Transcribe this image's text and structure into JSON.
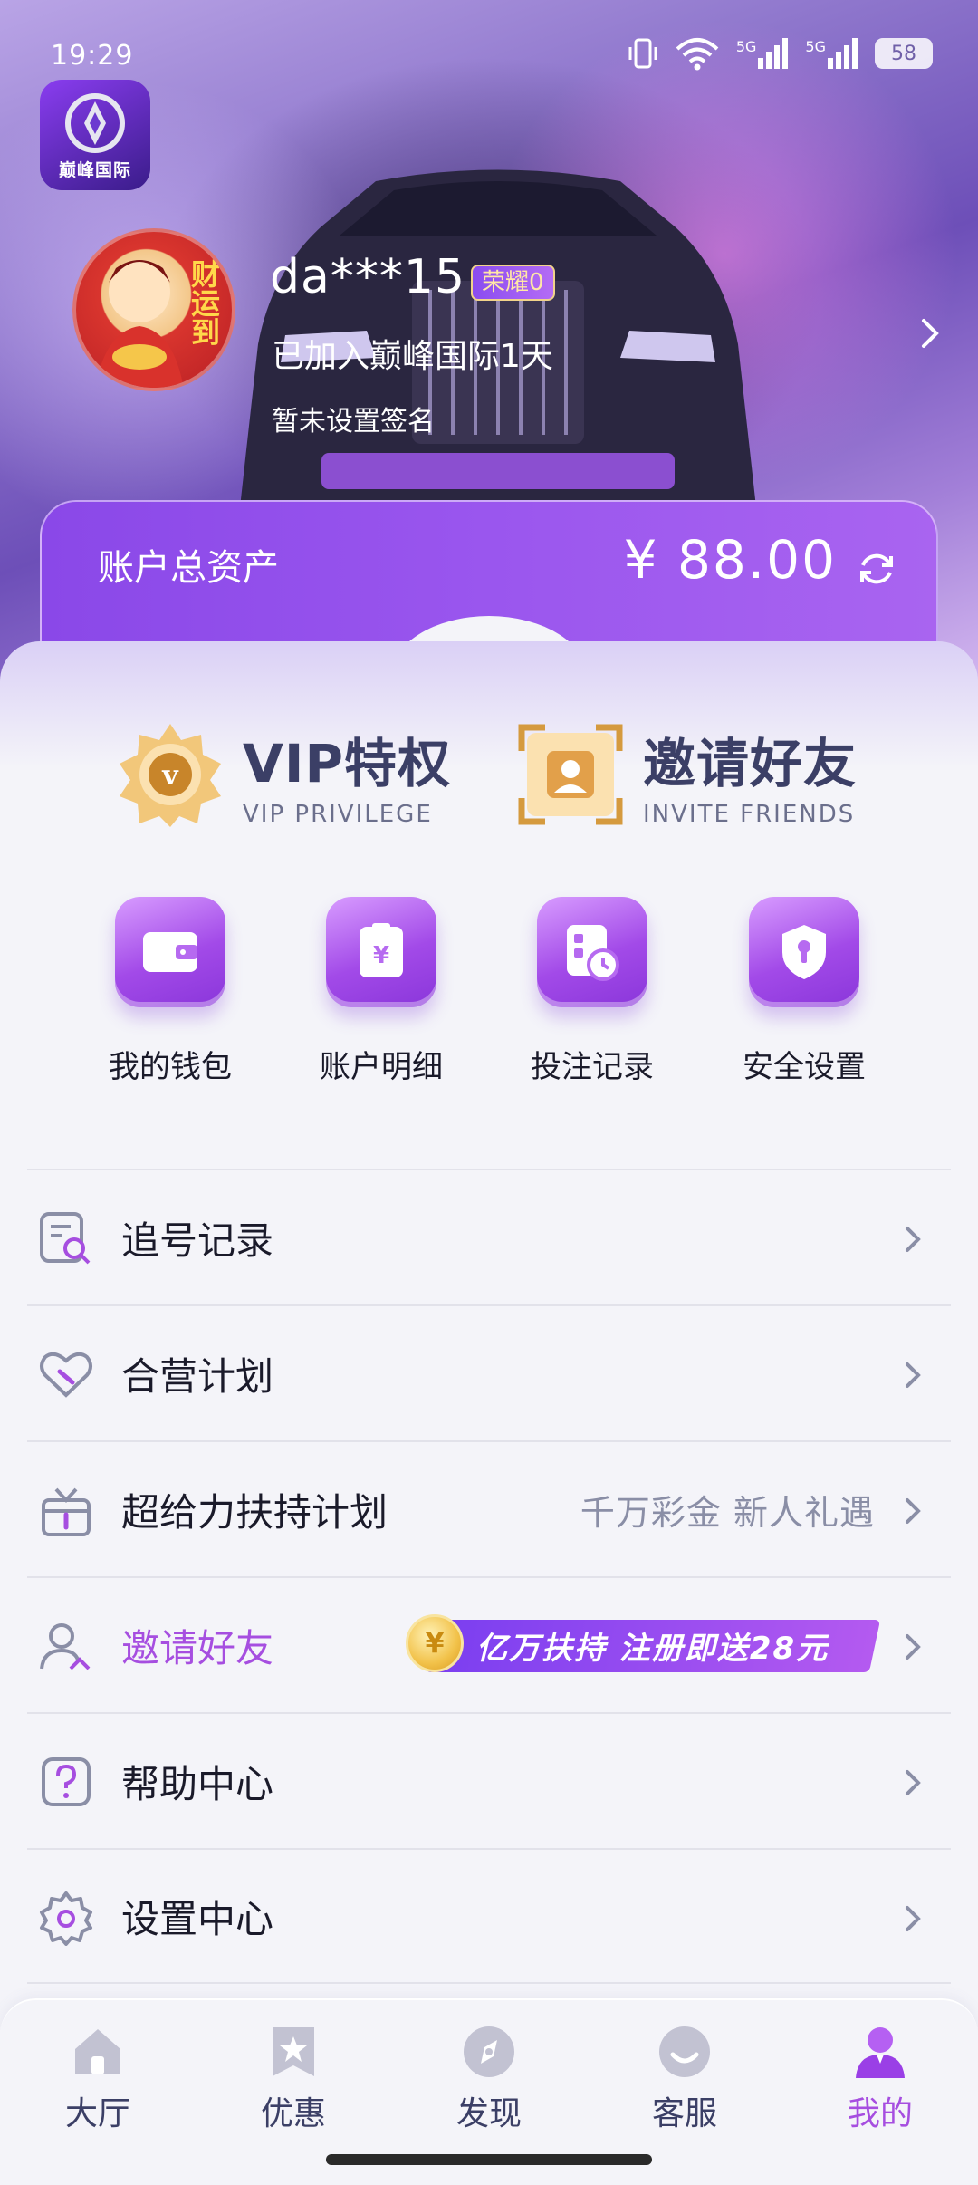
{
  "status": {
    "time": "19:29",
    "network_1": "5G",
    "network_2": "5G",
    "battery": "58"
  },
  "app": {
    "logo_text": "巅峰国际"
  },
  "profile": {
    "avatar_text": "财运到",
    "username": "da***15",
    "vip_badge": "荣耀0",
    "joined": "已加入巅峰国际1天",
    "signature": "暂未设置签名"
  },
  "assets": {
    "label": "账户总资产",
    "value": "¥ 88.00"
  },
  "features": [
    {
      "title": "VIP特权",
      "subtitle": "VIP PRIVILEGE",
      "icon": "vip-medal-icon"
    },
    {
      "title": "邀请好友",
      "subtitle": "INVITE FRIENDS",
      "icon": "invite-card-icon"
    }
  ],
  "quick_actions": [
    {
      "label": "我的钱包",
      "icon": "wallet-icon"
    },
    {
      "label": "账户明细",
      "icon": "yuan-receipt-icon"
    },
    {
      "label": "投注记录",
      "icon": "bet-record-icon"
    },
    {
      "label": "安全设置",
      "icon": "shield-icon"
    }
  ],
  "menu": [
    {
      "label": "追号记录",
      "icon": "search-record-icon",
      "extra": ""
    },
    {
      "label": "合营计划",
      "icon": "heart-handshake-icon",
      "extra": ""
    },
    {
      "label": "超给力扶持计划",
      "icon": "gift-icon",
      "extra": "千万彩金 新人礼遇"
    },
    {
      "label": "邀请好友",
      "icon": "users-icon",
      "extra": "",
      "promo": "亿万扶持 注册即送28元",
      "promo_coin": "¥"
    },
    {
      "label": "帮助中心",
      "icon": "help-icon",
      "extra": ""
    },
    {
      "label": "设置中心",
      "icon": "settings-icon",
      "extra": ""
    }
  ],
  "tabs": [
    {
      "label": "大厅",
      "icon": "home-icon",
      "active": false
    },
    {
      "label": "优惠",
      "icon": "star-bookmark-icon",
      "active": false
    },
    {
      "label": "发现",
      "icon": "compass-icon",
      "active": false
    },
    {
      "label": "客服",
      "icon": "support-icon",
      "active": false
    },
    {
      "label": "我的",
      "icon": "profile-icon",
      "active": true
    }
  ],
  "colors": {
    "accent": "#a64ee0",
    "card": "#9a56ee",
    "text": "#1a1a2a",
    "muted": "#8a8ea6"
  }
}
